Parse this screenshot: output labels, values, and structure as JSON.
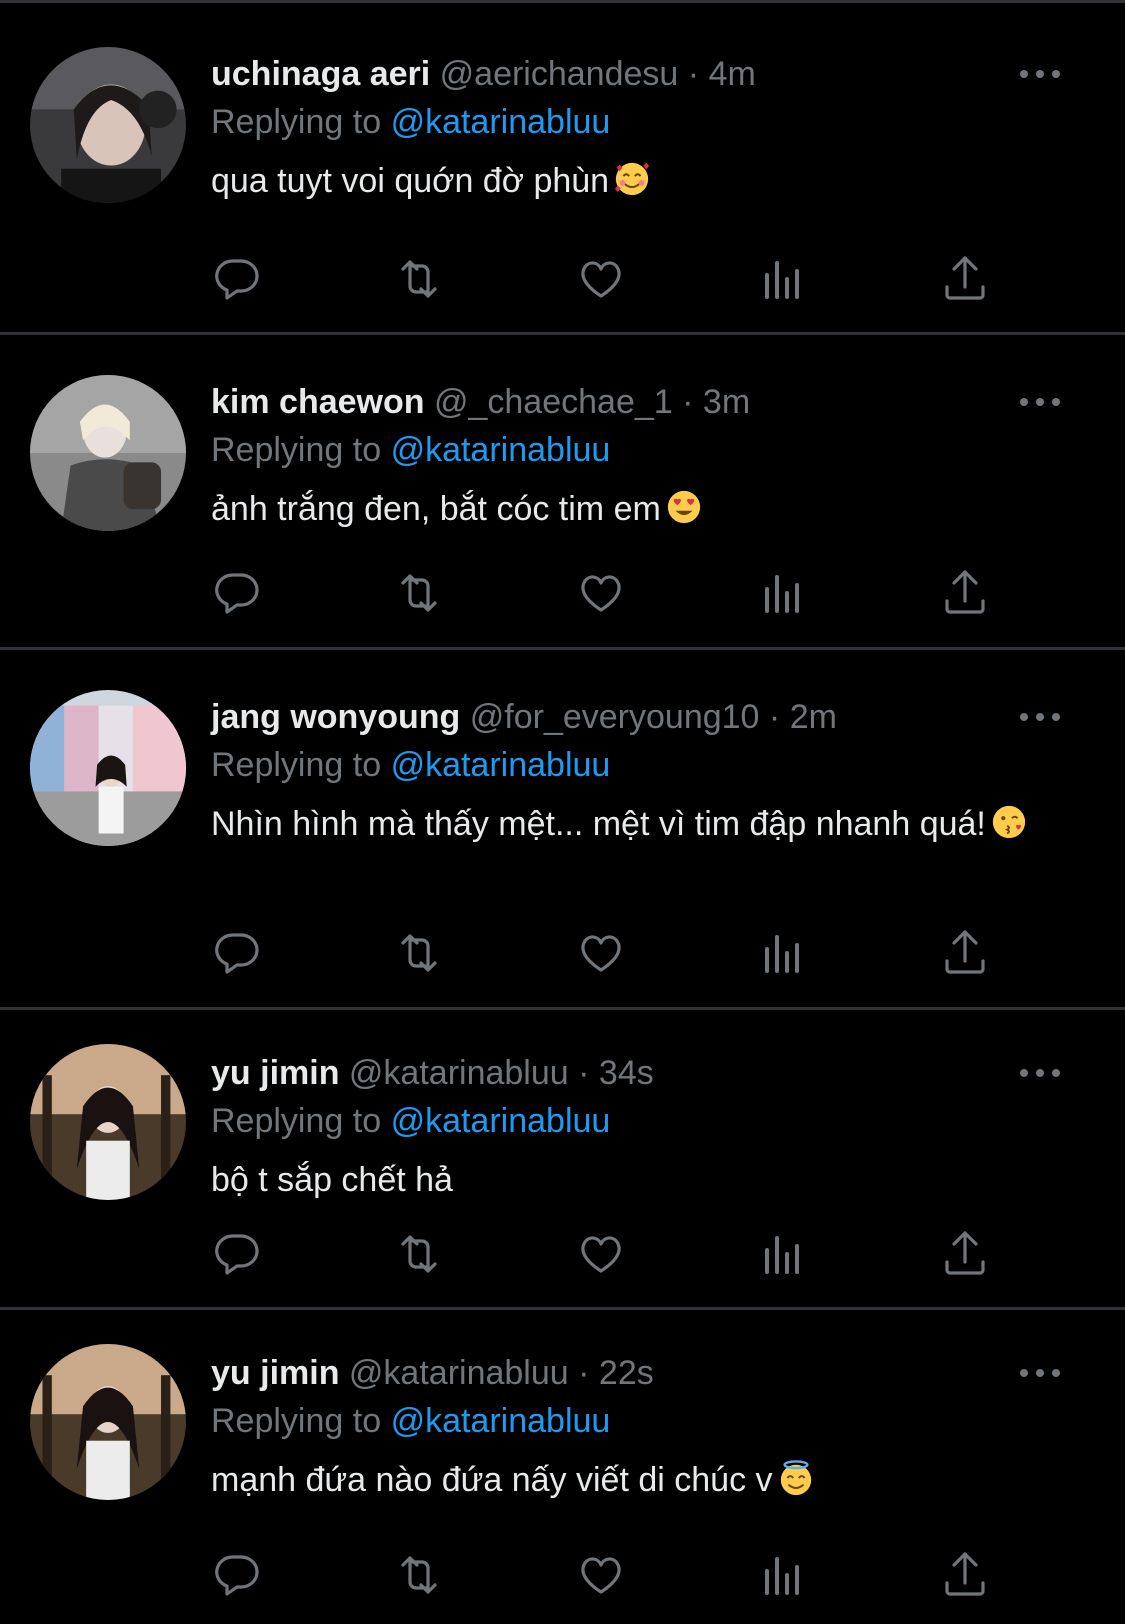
{
  "colors": {
    "background": "#000000",
    "separator": "#2f3336",
    "primary_text": "#e7e9ea",
    "secondary_text": "#71767b",
    "mention": "#1d9bf0"
  },
  "replying_prefix": "Replying to",
  "replying_handle": "@katarinabluu",
  "dot": "·",
  "action_icons": [
    "reply-icon",
    "retweet-icon",
    "like-icon",
    "views-icon",
    "share-icon"
  ],
  "tweets": [
    {
      "display_name": "uchinaga aeri",
      "handle": "@aerichandesu",
      "time": "4m",
      "text": "qua tuyt voi quớn đờ phùn",
      "emoji": "smiling-face-with-hearts"
    },
    {
      "display_name": "kim chaewon",
      "handle": "@_chaechae_1",
      "time": "3m",
      "text": "ảnh trắng đen, bắt cóc tim em",
      "emoji": "heart-eyes"
    },
    {
      "display_name": "jang wonyoung",
      "handle": "@for_everyoung10",
      "time": "2m",
      "text": "Nhìn hình mà thấy mệt... mệt vì tim đập nhanh quá!",
      "emoji": "kissing-face"
    },
    {
      "display_name": "yu jimin",
      "handle": "@katarinabluu",
      "time": "34s",
      "text": "bộ t sắp chết hả",
      "emoji": ""
    },
    {
      "display_name": "yu jimin",
      "handle": "@katarinabluu",
      "time": "22s",
      "text": "mạnh đứa nào đứa nấy viết di chúc v",
      "emoji": "halo-face"
    }
  ]
}
